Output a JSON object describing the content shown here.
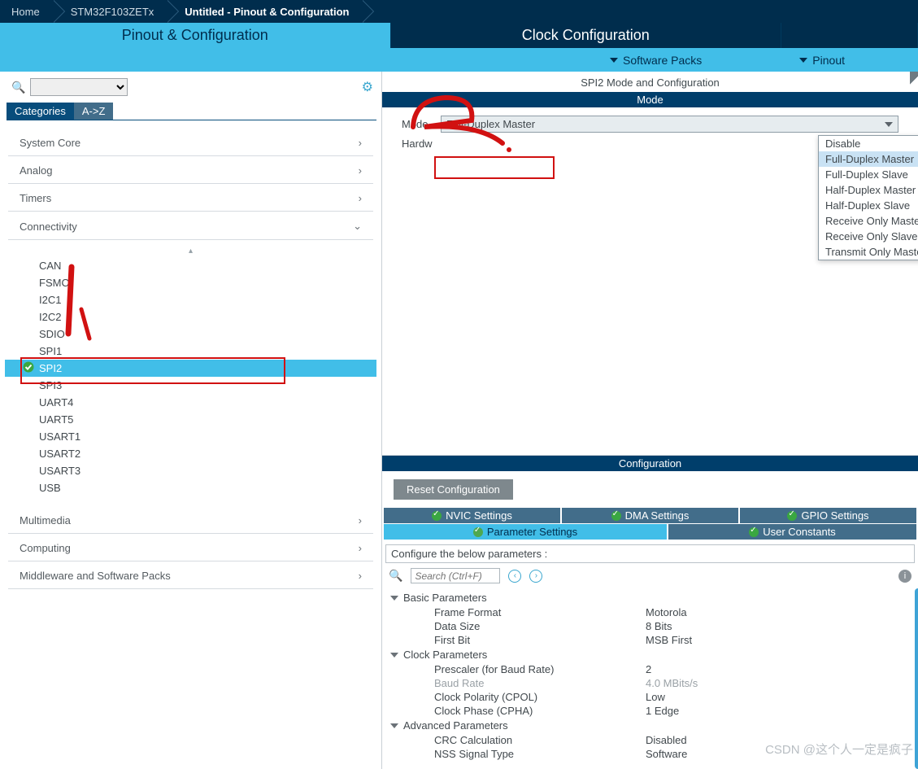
{
  "breadcrumb": {
    "home": "Home",
    "chip": "STM32F103ZETx",
    "page": "Untitled - Pinout & Configuration"
  },
  "tabs": {
    "pinout": "Pinout & Configuration",
    "clock": "Clock Configuration"
  },
  "submenu": {
    "packs": "Software Packs",
    "pinout": "Pinout"
  },
  "left": {
    "cat": "Categories",
    "az": "A->Z",
    "sections": [
      {
        "name": "System Core",
        "expanded": false
      },
      {
        "name": "Analog",
        "expanded": false
      },
      {
        "name": "Timers",
        "expanded": false
      },
      {
        "name": "Connectivity",
        "expanded": true
      },
      {
        "name": "Multimedia",
        "expanded": false
      },
      {
        "name": "Computing",
        "expanded": false
      },
      {
        "name": "Middleware and Software Packs",
        "expanded": false
      }
    ],
    "connectivity_items": [
      "CAN",
      "FSMC",
      "I2C1",
      "I2C2",
      "SDIO",
      "SPI1",
      "SPI2",
      "SPI3",
      "UART4",
      "UART5",
      "USART1",
      "USART2",
      "USART3",
      "USB"
    ],
    "selected": "SPI2"
  },
  "right": {
    "title": "SPI2 Mode and Configuration",
    "mode_bar": "Mode",
    "mode_label": "Mode",
    "mode_value": "Full-Duplex Master",
    "hw_label": "Hardw",
    "dropdown": [
      "Disable",
      "Full-Duplex Master",
      "Full-Duplex Slave",
      "Half-Duplex Master",
      "Half-Duplex Slave",
      "Receive Only Master",
      "Receive Only Slave",
      "Transmit Only Master"
    ],
    "dropdown_hl": "Full-Duplex Master",
    "config_bar": "Configuration",
    "reset": "Reset Configuration",
    "tabs": {
      "nvic": "NVIC Settings",
      "dma": "DMA Settings",
      "gpio": "GPIO Settings",
      "param": "Parameter Settings",
      "user": "User Constants"
    },
    "cfg_label": "Configure the below parameters :",
    "search_ph": "Search (Ctrl+F)",
    "groups": [
      {
        "name": "Basic Parameters",
        "rows": [
          {
            "n": "Frame Format",
            "v": "Motorola"
          },
          {
            "n": "Data Size",
            "v": "8 Bits"
          },
          {
            "n": "First Bit",
            "v": "MSB First"
          }
        ]
      },
      {
        "name": "Clock Parameters",
        "rows": [
          {
            "n": "Prescaler (for Baud Rate)",
            "v": "2"
          },
          {
            "n": "Baud Rate",
            "v": "4.0 MBits/s",
            "disabled": true
          },
          {
            "n": "Clock Polarity (CPOL)",
            "v": "Low"
          },
          {
            "n": "Clock Phase (CPHA)",
            "v": "1 Edge"
          }
        ]
      },
      {
        "name": "Advanced Parameters",
        "rows": [
          {
            "n": "CRC Calculation",
            "v": "Disabled"
          },
          {
            "n": "NSS Signal Type",
            "v": "Software"
          }
        ]
      }
    ]
  },
  "watermark": "CSDN @这个人一定是疯子"
}
